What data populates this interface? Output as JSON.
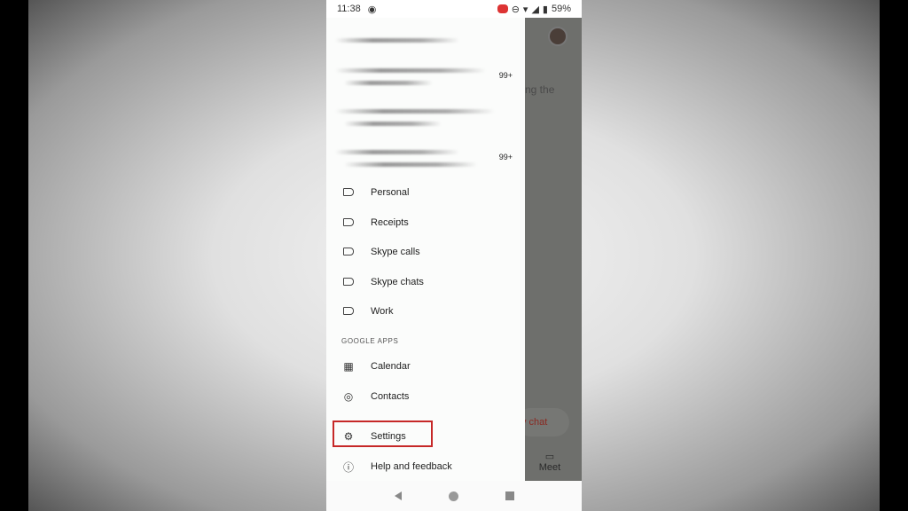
{
  "status": {
    "time": "11:38",
    "battery": "59%"
  },
  "accounts": [
    {
      "count": ""
    },
    {
      "count": "99+"
    },
    {
      "count": ""
    },
    {
      "count": "99+"
    }
  ],
  "labels": [
    {
      "label": "Personal",
      "icon": "label-icon"
    },
    {
      "label": "Receipts",
      "icon": "label-icon"
    },
    {
      "label": "Skype calls",
      "icon": "label-icon"
    },
    {
      "label": "Skype chats",
      "icon": "label-icon"
    },
    {
      "label": "Work",
      "icon": "label-icon"
    }
  ],
  "google_apps": {
    "heading": "GOOGLE APPS",
    "items": [
      {
        "label": "Calendar",
        "icon": "calendar-icon"
      },
      {
        "label": "Contacts",
        "icon": "contacts-icon"
      }
    ]
  },
  "bottom": [
    {
      "label": "Settings",
      "icon": "gear-icon"
    },
    {
      "label": "Help and feedback",
      "icon": "help-icon"
    }
  ],
  "behind": {
    "text": "ng the",
    "chat": "v chat",
    "meet": "Meet"
  },
  "highlight_color": "#c62828"
}
